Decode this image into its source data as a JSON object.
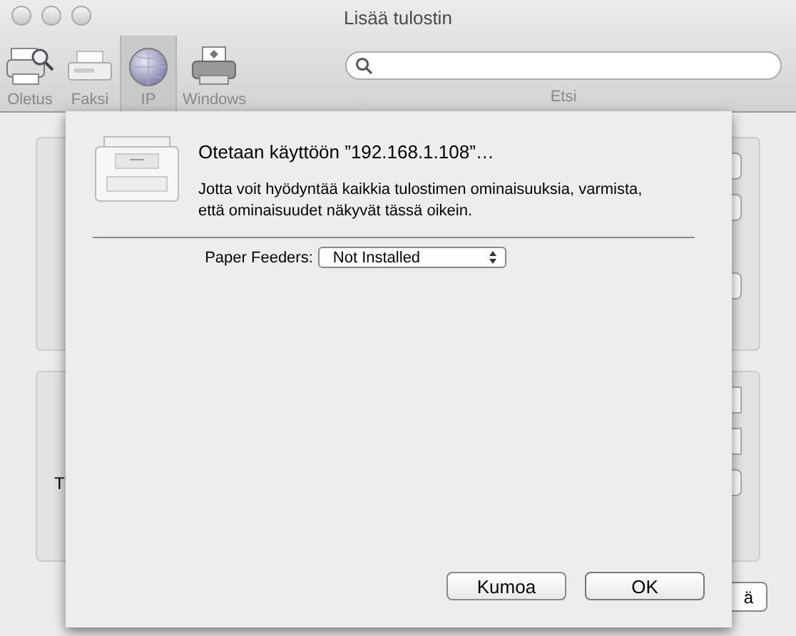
{
  "window": {
    "title": "Lisää tulostin"
  },
  "toolbar": {
    "items": [
      {
        "label": "Oletus",
        "kind": "default",
        "selected": false
      },
      {
        "label": "Faksi",
        "kind": "fax",
        "selected": false
      },
      {
        "label": "IP",
        "kind": "ip",
        "selected": true
      },
      {
        "label": "Windows",
        "kind": "windows",
        "selected": false
      }
    ],
    "search": {
      "label": "Etsi"
    }
  },
  "background": {
    "fields": [
      {
        "kind": "text"
      },
      {
        "kind": "text"
      },
      {
        "label": "T",
        "kind": "popup"
      }
    ],
    "add_button": "ä"
  },
  "sheet": {
    "title": "Otetaan käyttöön ”192.168.1.108”…",
    "message": "Jotta voit hyödyntää kaikkia tulostimen ominaisuuksia, varmista, että ominaisuudet näkyvät tässä oikein.",
    "options": [
      {
        "label": "Paper Feeders:",
        "value": "Not Installed"
      }
    ],
    "buttons": [
      {
        "label": "Kumoa",
        "kind": "cancel"
      },
      {
        "label": "OK",
        "kind": "ok"
      }
    ]
  }
}
